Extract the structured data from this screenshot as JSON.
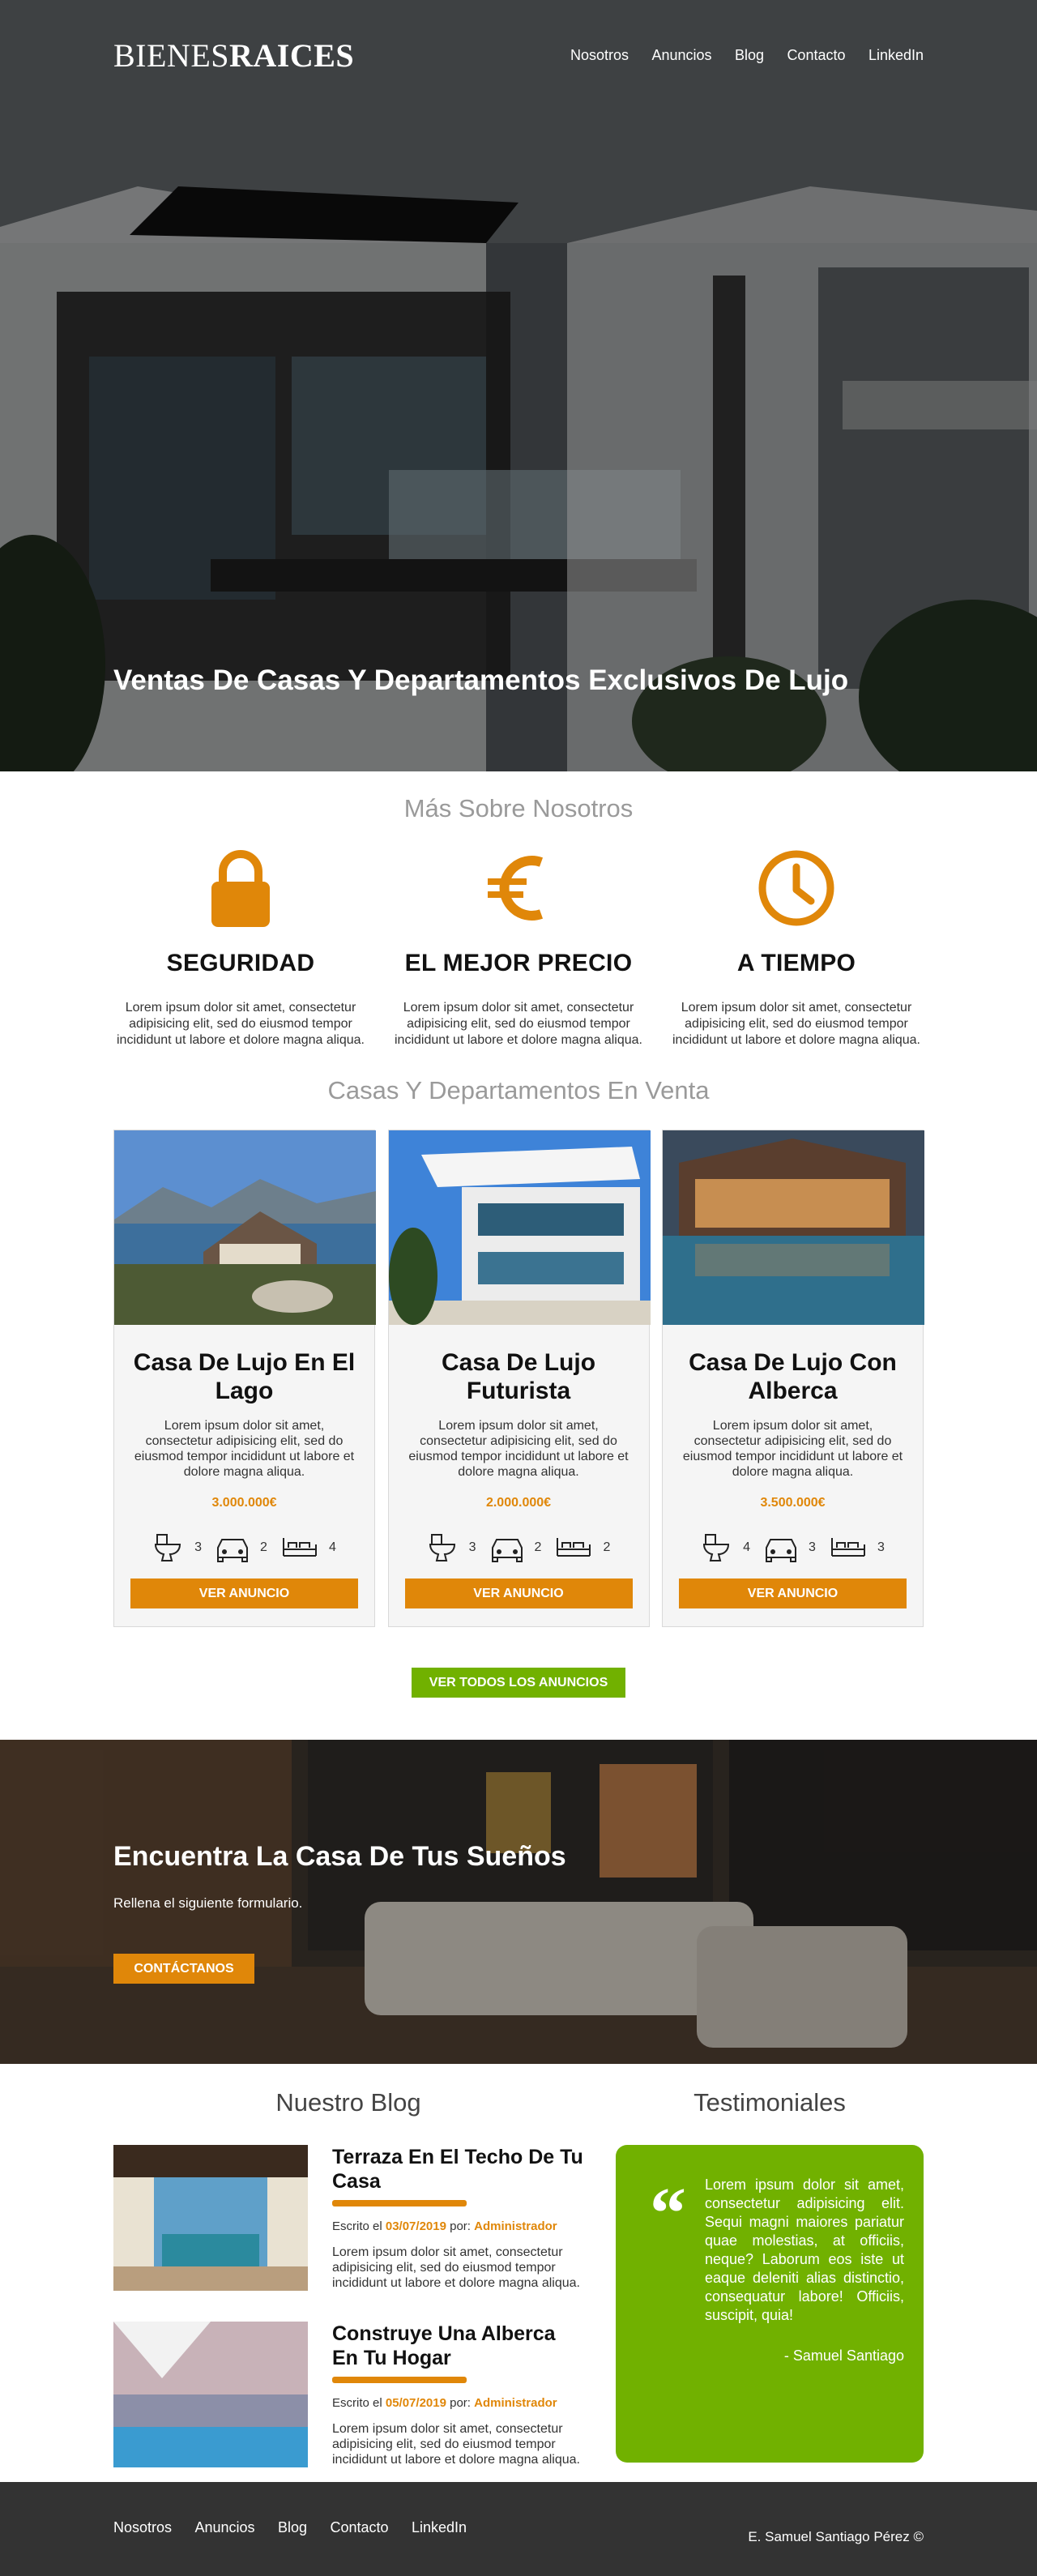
{
  "brand": {
    "logo_light": "BIENES",
    "logo_bold": "RAICES"
  },
  "nav": [
    "Nosotros",
    "Anuncios",
    "Blog",
    "Contacto",
    "LinkedIn"
  ],
  "hero": {
    "title": "Ventas De Casas Y Departamentos Exclusivos De Lujo"
  },
  "about": {
    "title": "Más Sobre Nosotros",
    "items": [
      {
        "icon": "lock-icon",
        "title": "SEGURIDAD",
        "text": "Lorem ipsum dolor sit amet, consectetur adipisicing elit, sed do eiusmod tempor incididunt ut labore et dolore magna aliqua."
      },
      {
        "icon": "euro-icon",
        "title": "EL MEJOR PRECIO",
        "text": "Lorem ipsum dolor sit amet, consectetur adipisicing elit, sed do eiusmod tempor incididunt ut labore et dolore magna aliqua."
      },
      {
        "icon": "clock-icon",
        "title": "A TIEMPO",
        "text": "Lorem ipsum dolor sit amet, consectetur adipisicing elit, sed do eiusmod tempor incididunt ut labore et dolore magna aliqua."
      }
    ]
  },
  "listings": {
    "title": "Casas Y Departamentos En Venta",
    "cards": [
      {
        "title": "Casa De Lujo En El Lago",
        "text": "Lorem ipsum dolor sit amet, consectetur adipisicing elit, sed do eiusmod tempor incididunt ut labore et dolore magna aliqua.",
        "price": "3.000.000€",
        "wc": "3",
        "parking": "2",
        "bedrooms": "4",
        "button": "VER ANUNCIO"
      },
      {
        "title": "Casa De Lujo Futurista",
        "text": "Lorem ipsum dolor sit amet, consectetur adipisicing elit, sed do eiusmod tempor incididunt ut labore et dolore magna aliqua.",
        "price": "2.000.000€",
        "wc": "3",
        "parking": "2",
        "bedrooms": "2",
        "button": "VER ANUNCIO"
      },
      {
        "title": "Casa De Lujo Con Alberca",
        "text": "Lorem ipsum dolor sit amet, consectetur adipisicing elit, sed do eiusmod tempor incididunt ut labore et dolore magna aliqua.",
        "price": "3.500.000€",
        "wc": "4",
        "parking": "3",
        "bedrooms": "3",
        "button": "VER ANUNCIO"
      }
    ],
    "see_all": "VER TODOS LOS ANUNCIOS"
  },
  "dream": {
    "title": "Encuentra La Casa De Tus Sueños",
    "subtitle": "Rellena el siguiente formulario.",
    "button": "CONTÁCTANOS"
  },
  "blog": {
    "title": "Nuestro Blog",
    "posts": [
      {
        "title": "Terraza En El Techo De Tu Casa",
        "written": "Escrito el ",
        "date": "03/07/2019",
        "by": " por: ",
        "author": "Administrador",
        "text": "Lorem ipsum dolor sit amet, consectetur adipisicing elit, sed do eiusmod tempor incididunt ut labore et dolore magna aliqua."
      },
      {
        "title": "Construye Una Alberca En Tu Hogar",
        "written": "Escrito el ",
        "date": "05/07/2019",
        "by": " por: ",
        "author": "Administrador",
        "text": "Lorem ipsum dolor sit amet, consectetur adipisicing elit, sed do eiusmod tempor incididunt ut labore et dolore magna aliqua."
      }
    ]
  },
  "testimonials": {
    "title": "Testimoniales",
    "quote_mark": "“",
    "quote": "Lorem ipsum dolor sit amet, consectetur adipisicing elit. Sequi magni maiores pariatur quae molestias, at officiis, neque? Laborum eos iste ut eaque deleniti alias distinctio, consequatur labore! Officiis, suscipit, quia!",
    "author": "- Samuel Santiago"
  },
  "footer": {
    "nav": [
      "Nosotros",
      "Anuncios",
      "Blog",
      "Contacto",
      "LinkedIn"
    ],
    "copyright": "E. Samuel Santiago Pérez ©"
  },
  "colors": {
    "accent": "#e08709",
    "green": "#71b100",
    "footer_bg": "#333333"
  }
}
